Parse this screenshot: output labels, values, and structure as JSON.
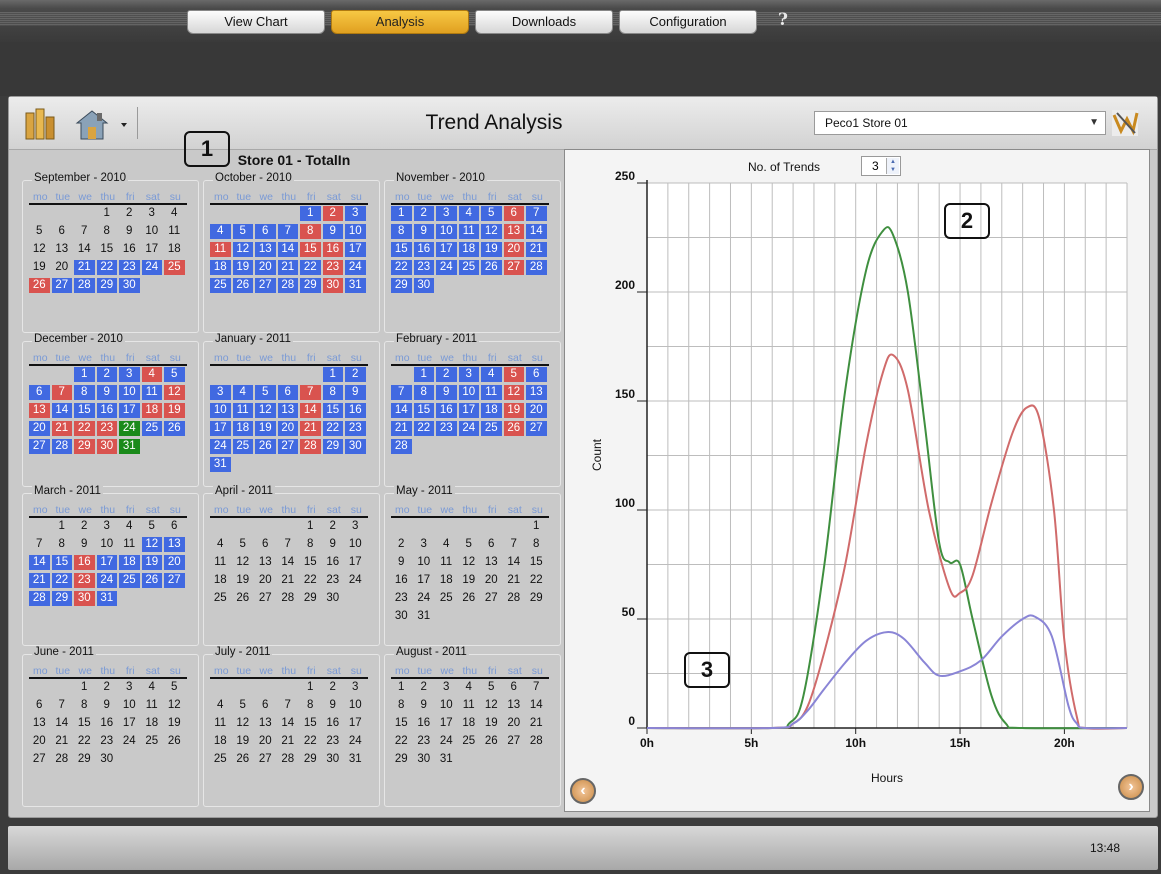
{
  "nav": {
    "tabs": [
      {
        "label": "View Chart",
        "active": false
      },
      {
        "label": "Analysis",
        "active": true
      },
      {
        "label": "Downloads",
        "active": false
      },
      {
        "label": "Configuration",
        "active": false
      }
    ],
    "help": "?"
  },
  "header": {
    "title": "Trend Analysis",
    "store_select": "Peco1 Store 01",
    "icons": [
      "bar-chart-icon",
      "home-menu-icon",
      "apply-icon"
    ]
  },
  "calendar": {
    "title": "Store 01 - TotalIn",
    "dow": [
      "mo",
      "tue",
      "we",
      "thu",
      "fri",
      "sat",
      "su"
    ],
    "months": [
      {
        "name": "September - 2010",
        "offset": 3,
        "days": 30,
        "colors": "...................................................................................................bbbbrrbbbb"
      },
      {
        "name": "October - 2010",
        "offset": 4,
        "days": 31,
        "colors": "brbbbbbrbbrbbbrrbbbbbbrbbbbbbrb"
      },
      {
        "name": "November - 2010",
        "offset": 0,
        "days": 30,
        "colors": "bbbbbrbbbbbbrbbbbbbrbbbbbbrbbb"
      },
      {
        "name": "December - 2010",
        "offset": 2,
        "days": 31,
        "colors": "bbbrbbrbbbbrrbbbbrrbrrrgbbbbrrg"
      },
      {
        "name": "January - 2011",
        "offset": 5,
        "days": 31,
        "colors": "bbbbbbbrbbbbbbrbbbbbbrbbbbbbrbbb"
      },
      {
        "name": "February - 2011",
        "offset": 1,
        "days": 28,
        "colors": "bbbbrbbbbbbrbbbbbbrbbbbbbrbb"
      },
      {
        "name": "March - 2011",
        "offset": 1,
        "days": 31,
        "colors": "bbbbrbbbbbbrbbbbbbrb..........."
      },
      {
        "name": "April - 2011",
        "offset": 4,
        "days": 30,
        "colors": ""
      },
      {
        "name": "May - 2011",
        "offset": 6,
        "days": 31,
        "colors": ""
      },
      {
        "name": "June - 2011",
        "offset": 2,
        "days": 30,
        "colors": ""
      },
      {
        "name": "July - 2011",
        "offset": 4,
        "days": 31,
        "colors": ""
      },
      {
        "name": "August - 2011",
        "offset": 0,
        "days": 31,
        "colors": ""
      }
    ]
  },
  "markers": [
    "1",
    "2",
    "3"
  ],
  "trends": {
    "label": "No. of Trends",
    "value": "3"
  },
  "chart_data": {
    "type": "line",
    "xlabel": "Hours",
    "ylabel": "Count",
    "xlim": [
      0,
      23
    ],
    "ylim": [
      0,
      250
    ],
    "xticks": [
      "0h",
      "5h",
      "10h",
      "15h",
      "20h"
    ],
    "xtick_values": [
      0,
      5,
      10,
      15,
      20
    ],
    "yticks": [
      "0",
      "50",
      "100",
      "150",
      "200",
      "250"
    ],
    "ytick_values": [
      0,
      50,
      100,
      150,
      200,
      250
    ],
    "grid": true,
    "series": [
      {
        "color": "#3f8f3f",
        "points": [
          [
            0,
            0
          ],
          [
            6,
            0
          ],
          [
            6.8,
            2
          ],
          [
            7.5,
            15
          ],
          [
            8.5,
            75
          ],
          [
            9.5,
            155
          ],
          [
            10.5,
            210
          ],
          [
            11.3,
            228
          ],
          [
            11.8,
            226
          ],
          [
            12.5,
            200
          ],
          [
            13.3,
            140
          ],
          [
            14,
            85
          ],
          [
            14.5,
            76
          ],
          [
            15,
            75
          ],
          [
            15.6,
            50
          ],
          [
            16.5,
            15
          ],
          [
            17.2,
            2
          ],
          [
            18,
            0
          ],
          [
            23,
            0
          ]
        ]
      },
      {
        "color": "#d06b6b",
        "points": [
          [
            0,
            0
          ],
          [
            6,
            0
          ],
          [
            7,
            2
          ],
          [
            7.7,
            10
          ],
          [
            8.5,
            35
          ],
          [
            9.5,
            75
          ],
          [
            10.5,
            130
          ],
          [
            11.3,
            163
          ],
          [
            11.8,
            171
          ],
          [
            12.5,
            155
          ],
          [
            13.5,
            100
          ],
          [
            14.5,
            64
          ],
          [
            15,
            62
          ],
          [
            15.6,
            70
          ],
          [
            16.5,
            103
          ],
          [
            17.5,
            135
          ],
          [
            18.2,
            147
          ],
          [
            18.8,
            142
          ],
          [
            19.5,
            100
          ],
          [
            20,
            40
          ],
          [
            20.6,
            5
          ],
          [
            21,
            0
          ],
          [
            23,
            0
          ]
        ]
      },
      {
        "color": "#8a85d6",
        "points": [
          [
            0,
            0
          ],
          [
            6,
            0
          ],
          [
            7,
            2
          ],
          [
            7.7,
            8
          ],
          [
            8.5,
            18
          ],
          [
            9.5,
            30
          ],
          [
            10.5,
            40
          ],
          [
            11.5,
            44
          ],
          [
            12.3,
            41
          ],
          [
            13.3,
            30
          ],
          [
            14,
            24
          ],
          [
            15,
            26
          ],
          [
            16,
            31
          ],
          [
            17,
            42
          ],
          [
            18,
            50
          ],
          [
            18.6,
            51
          ],
          [
            19.4,
            42
          ],
          [
            20.2,
            10
          ],
          [
            20.6,
            2
          ],
          [
            21,
            0
          ],
          [
            23,
            0
          ]
        ]
      }
    ]
  },
  "status": {
    "clock": "13:48"
  }
}
